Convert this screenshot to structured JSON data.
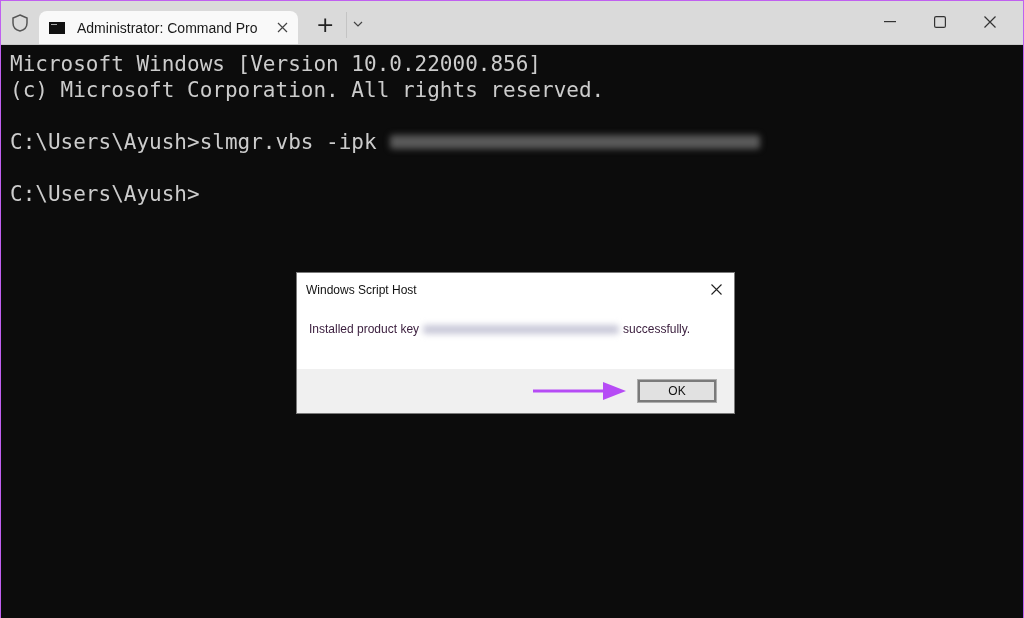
{
  "window": {
    "tab_title": "Administrator: Command Pro",
    "new_tab": "+"
  },
  "terminal": {
    "blocks": [
      {
        "lines": [
          {
            "text": "Microsoft Windows [Version 10.0.22000.856]",
            "redacted_key": false
          },
          {
            "text": "(c) Microsoft Corporation. All rights reserved.",
            "redacted_key": false
          }
        ]
      },
      {
        "lines": [
          {
            "text": "C:\\Users\\Ayush>slmgr.vbs -ipk",
            "redacted_key": true
          }
        ]
      },
      {
        "lines": [
          {
            "text": "C:\\Users\\Ayush>",
            "redacted_key": false
          }
        ]
      }
    ]
  },
  "dialog": {
    "title": "Windows Script Host",
    "message_before": "Installed product key",
    "message_after": "successfully.",
    "button": "OK"
  }
}
